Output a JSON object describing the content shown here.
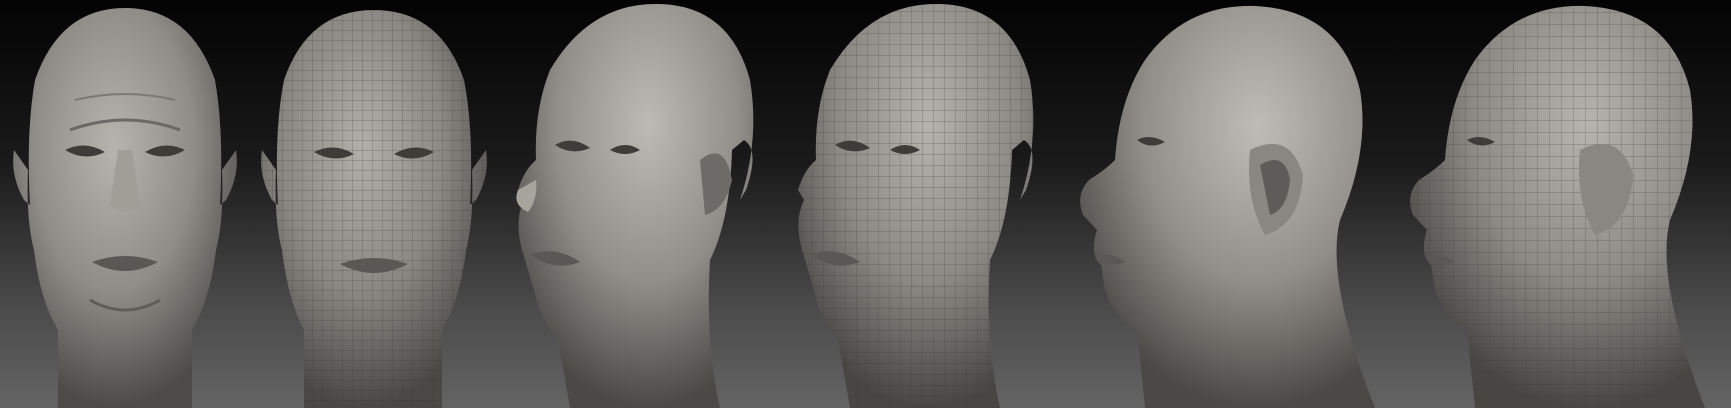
{
  "image": {
    "description_for_rendering_only": false,
    "background_colors": [
      "#030303",
      "#1a1a1a",
      "#4a4a4a",
      "#646464"
    ],
    "clay_color": "#8f8d88",
    "clay_shadow": "#55534f",
    "clay_highlight": "#c3c0ba",
    "wire_color": "#3c3b38"
  },
  "views": [
    {
      "id": "front",
      "wireframe": false,
      "direction": 0
    },
    {
      "id": "front",
      "wireframe": true,
      "direction": 0
    },
    {
      "id": "three-quarter",
      "wireframe": false,
      "direction": -1
    },
    {
      "id": "three-quarter",
      "wireframe": true,
      "direction": -1
    },
    {
      "id": "profile",
      "wireframe": false,
      "direction": -2
    },
    {
      "id": "profile",
      "wireframe": true,
      "direction": -2
    }
  ]
}
